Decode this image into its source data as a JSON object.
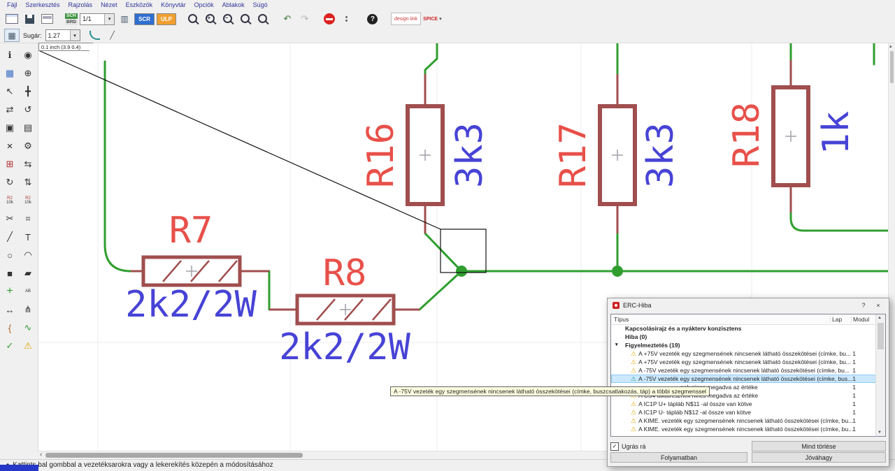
{
  "menu": {
    "items": [
      "Fájl",
      "Szerkesztés",
      "Rajzolás",
      "Nézet",
      "Eszközök",
      "Könyvtár",
      "Opciók",
      "Ablakok",
      "Súgó"
    ]
  },
  "toolbar": {
    "sch_label": "SCH",
    "brd_label": "BRD",
    "sheet": "1/1",
    "scr": "SCR",
    "ulp": "ULP",
    "zoom_in_sign": "+",
    "zoom_out_sign": "−",
    "design_link": "design link",
    "spice": "SPICE"
  },
  "toolbar2": {
    "radius_label": "Sugár:",
    "radius_value": "1.27"
  },
  "coordinate_readout": "0.1 inch (3.9 0.4)",
  "left_toolbar": {
    "items": [
      {
        "name": "info",
        "glyph": "ℹ"
      },
      {
        "name": "show-eye",
        "glyph": "◉"
      },
      {
        "name": "display-layers",
        "glyph": "▦",
        "color": "#3b6fc4"
      },
      {
        "name": "mark",
        "glyph": "⊕"
      },
      {
        "name": "select-group",
        "glyph": "↖"
      },
      {
        "name": "move",
        "glyph": "╋"
      },
      {
        "name": "mirror",
        "glyph": "⇄"
      },
      {
        "name": "rotate",
        "glyph": "↺"
      },
      {
        "name": "copy",
        "glyph": "▣"
      },
      {
        "name": "paste",
        "glyph": "▤"
      },
      {
        "name": "delete",
        "glyph": "×",
        "color": "#222",
        "size": 15
      },
      {
        "name": "change-wrench",
        "glyph": "⚙"
      },
      {
        "name": "add-part",
        "glyph": "⊞",
        "color": "#b03030"
      },
      {
        "name": "pinswap",
        "glyph": "⇆"
      },
      {
        "name": "replace",
        "glyph": "↻"
      },
      {
        "name": "gateswap",
        "glyph": "⇅"
      },
      {
        "name": "value",
        "lines": [
          "R2",
          "10k"
        ]
      },
      {
        "name": "name",
        "lines": [
          "R2",
          "10k"
        ]
      },
      {
        "name": "cut",
        "glyph": "✂"
      },
      {
        "name": "invoke",
        "glyph": "⌗"
      },
      {
        "name": "wire",
        "glyph": "╱",
        "color": "#333"
      },
      {
        "name": "text",
        "glyph": "T"
      },
      {
        "name": "circle",
        "glyph": "○"
      },
      {
        "name": "arc",
        "glyph": "◠"
      },
      {
        "name": "rect",
        "glyph": "■"
      },
      {
        "name": "polygon",
        "glyph": "▰"
      },
      {
        "name": "junction",
        "glyph": "+",
        "color": "#2f9e2f",
        "size": 16
      },
      {
        "name": "label",
        "lines": [
          "AB"
        ]
      },
      {
        "name": "dimension",
        "glyph": "↔"
      },
      {
        "name": "split",
        "glyph": "⋔"
      },
      {
        "name": "bus",
        "glyph": "{",
        "color": "#b06020"
      },
      {
        "name": "net",
        "glyph": "∿",
        "color": "#2f9e2f"
      },
      {
        "name": "erc",
        "glyph": "✓",
        "color": "#2f9e2f"
      },
      {
        "name": "erc-errors",
        "glyph": "⚠",
        "color": "#e2a600"
      }
    ]
  },
  "schematic": {
    "r7": {
      "name": "R7",
      "value": "2k2/2W"
    },
    "r8": {
      "name": "R8",
      "value": "2k2/2W"
    },
    "r16": {
      "name": "R16",
      "value": "3k3"
    },
    "r17": {
      "name": "R17",
      "value": "3k3"
    },
    "r18": {
      "name": "R18",
      "value": "1k"
    }
  },
  "colors": {
    "wire_green": "#2f9e2f",
    "symbol_maroon": "#a04e4e",
    "name_red": "#e8504a",
    "value_blue": "#4743d6"
  },
  "erc_dialog": {
    "title": "ERC-Hiba",
    "help_label": "?",
    "close_label": "×",
    "columns": [
      "Típus",
      "Lap",
      "Modul"
    ],
    "tree_headers": [
      {
        "label": "Kapcsolásirajz és a nyákterv konzisztens"
      },
      {
        "label": "Hiba (0)"
      },
      {
        "label": "Figyelmeztetés (19)",
        "expanded": true
      }
    ],
    "warnings": [
      {
        "text": "A +75V vezeték egy szegmensének nincsenek látható összekötései (címke, bu...",
        "sheet": "1"
      },
      {
        "text": "A +75V vezeték egy szegmensének nincsenek látható összekötései (címke, bu...",
        "sheet": "1"
      },
      {
        "text": "A -75V vezeték egy szegmensének nincsenek látható összekötései (címke, bu...",
        "sheet": "1"
      },
      {
        "text": "A -75V vezeték egy szegmensének nincsenek látható összekötései (címke, bus...",
        "sheet": "1",
        "selected": true
      },
      {
        "text": "nek nincs megadva az értéke",
        "sheet": "1",
        "partial": true
      },
      {
        "text": "A CS4 alkatrésznek nincs megadva az értéke",
        "sheet": "1"
      },
      {
        "text": "A IC1P U+ tápláb N$11 -al össze van kötve",
        "sheet": "1"
      },
      {
        "text": "A IC1P U- tápláb N$12 -al össze van kötve",
        "sheet": "1"
      },
      {
        "text": "A KIME. vezeték egy szegmensének nincsenek látható összekötései (címke, bu...",
        "sheet": "1"
      },
      {
        "text": "A KIME. vezeték egy szegmensének nincsenek látható összekötései (címke, bu...",
        "sheet": "1"
      }
    ],
    "jump_label": "Ugrás rá",
    "jump_checked": true,
    "buttons": {
      "clear_all": "Mind törlése",
      "processed": "Folyamatban",
      "approve": "Jóváhagy"
    }
  },
  "tooltip": "A -75V vezeték egy szegmensének nincsenek látható összekötései (címke, buszcsatlakozás, táp) a többi szegmenssel",
  "status_bar": {
    "text": "Kattints bal gombbal a vezetéksarokra vagy a lekerekítés közepén a módosításához"
  }
}
